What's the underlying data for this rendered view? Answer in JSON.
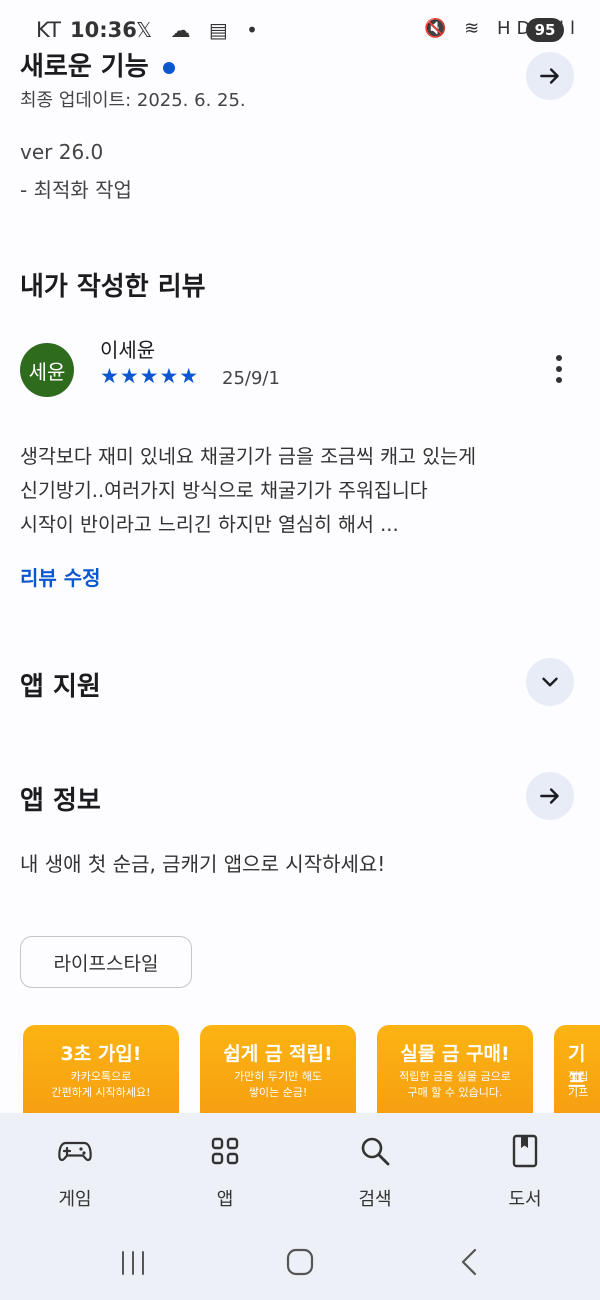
{
  "status": {
    "carrier": "KT",
    "time": "10:36",
    "left_icons": "𝕏 ☁ ▤ •",
    "right_icons": "🔇 ≋ HD ıll",
    "battery": "95"
  },
  "whats_new": {
    "title": "새로운 기능",
    "updated": "최종 업데이트: 2025. 6. 25.",
    "version": "ver 26.0",
    "note": "- 최적화 작업"
  },
  "my_review": {
    "heading": "내가 작성한 리뷰",
    "avatar_text": "세윤",
    "user": "이세윤",
    "stars": "★★★★★",
    "rating": 5,
    "date": "25/9/1",
    "lines": [
      "생각보다 재미 있네요 채굴기가   금을 조금씩 캐고 있는게",
      "신기방기..여러가지 방식으로 채굴기가 주워집니다",
      "시작이 반이라고 느리긴 하지만 열심히 해서 ..."
    ],
    "edit_link": "리뷰 수정"
  },
  "app_support": {
    "title": "앱 지원"
  },
  "app_info": {
    "title": "앱 정보",
    "description": "내 생애 첫 순금, 금캐기 앱으로 시작하세요!",
    "chip": "라이프스타일"
  },
  "screenshots": [
    {
      "title": "3초 가입!",
      "caption": "카카오톡으로\n간편하게 시작하세요!"
    },
    {
      "title": "쉽게 금 적립!",
      "caption": "가만히 두기만 해도\n쌓이는 순금!"
    },
    {
      "title": "실물 금 구매!",
      "caption": "적립한 금을 실물 금으로\n구매 할 수 있습니다."
    },
    {
      "title": "기프",
      "caption": "적립\n기프"
    }
  ],
  "bottom_nav": [
    {
      "label": "게임",
      "icon": "gamepad-icon"
    },
    {
      "label": "앱",
      "icon": "apps-grid-icon"
    },
    {
      "label": "검색",
      "icon": "search-icon"
    },
    {
      "label": "도서",
      "icon": "book-icon"
    }
  ],
  "colors": {
    "accent": "#0b57d0",
    "avatar_bg": "#2e6b1d",
    "button_bg": "#e8ecf7",
    "nav_bg": "#edf0f6"
  }
}
